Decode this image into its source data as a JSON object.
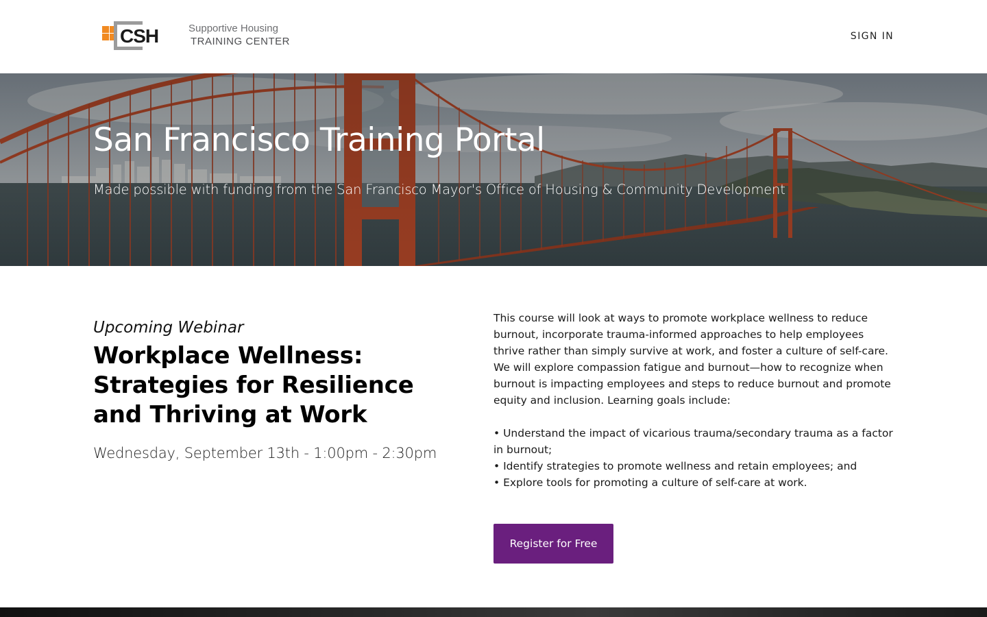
{
  "header": {
    "logo": {
      "mark_text": "CSH",
      "line1": "Supportive Housing",
      "line2": "TRAINING CENTER"
    },
    "sign_in_label": "SIGN IN"
  },
  "hero": {
    "title": "San Francisco Training Portal",
    "subtitle": "Made possible with funding from the San Francisco Mayor's Office of Housing & Community Development"
  },
  "course": {
    "eyebrow": "Upcoming Webinar",
    "title": "Workplace Wellness: Strategies for Resilience and Thriving at Work",
    "date": "Wednesday, September 13th - 1:00pm - 2:30pm",
    "description": "This course will look at ways to promote workplace wellness to reduce burnout, incorporate trauma-informed approaches to help employees thrive rather than simply survive at work, and foster a culture of self-care. We will explore compassion fatigue and burnout—how to recognize when burnout is impacting employees and steps to reduce burnout and promote equity and inclusion. Learning goals include:",
    "goals": [
      "• Understand the impact of vicarious trauma/secondary trauma as a factor in burnout;",
      "• Identify strategies to promote wellness and retain employees; and",
      "• Explore tools for promoting a culture of self-care at work."
    ],
    "register_label": "Register for Free"
  },
  "colors": {
    "brand_orange": "#f18a21",
    "brand_gray": "#8c8c8c",
    "button_purple": "#6a1f7e",
    "bridge_red": "#b84a2a"
  }
}
